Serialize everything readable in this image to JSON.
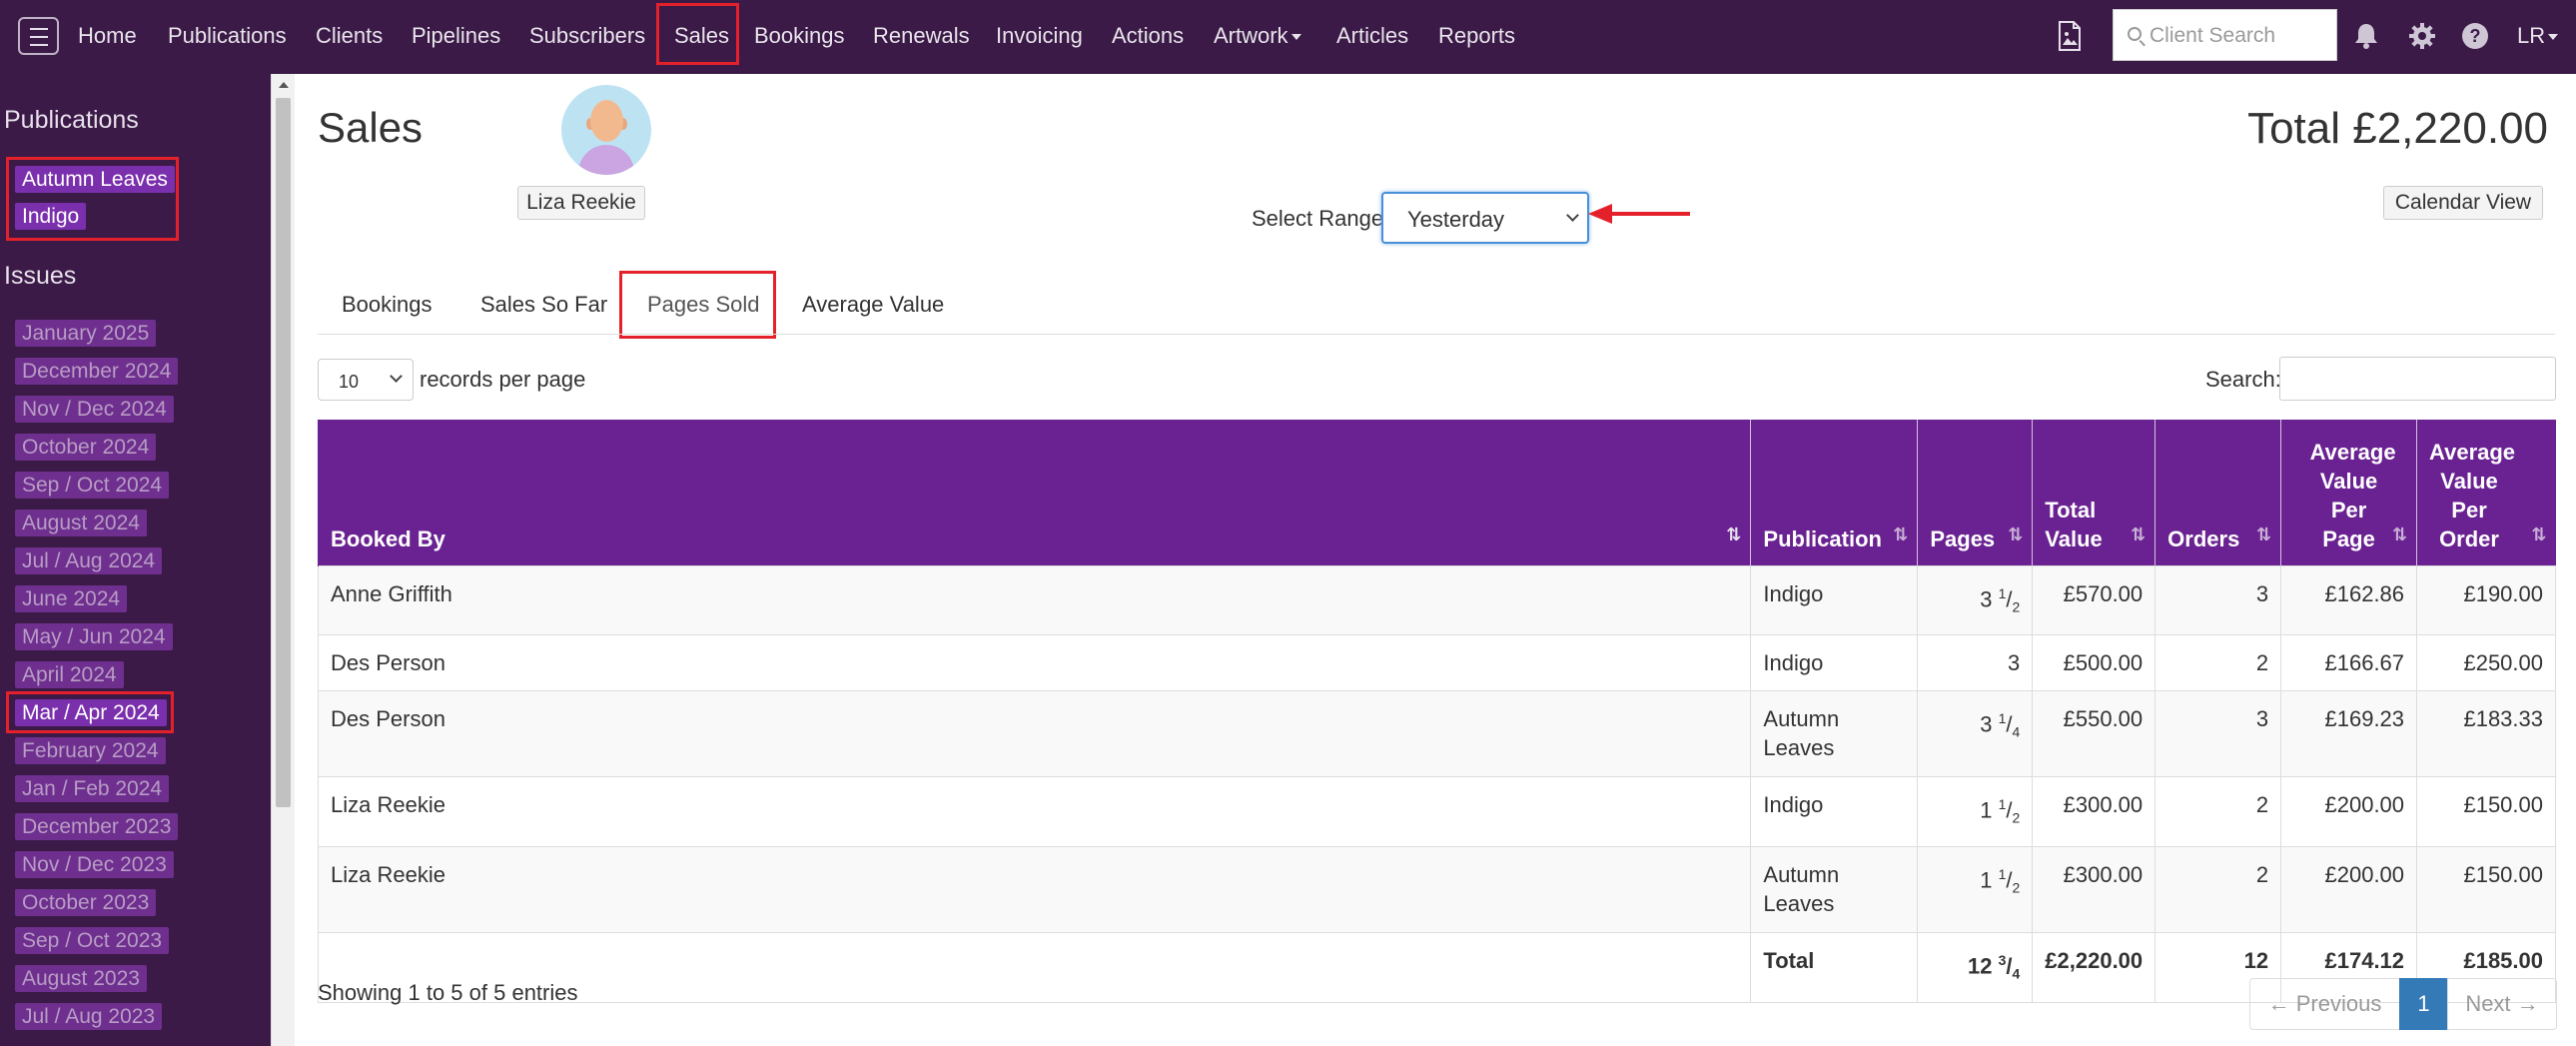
{
  "nav": {
    "items": [
      "Home",
      "Publications",
      "Clients",
      "Pipelines",
      "Subscribers",
      "Sales",
      "Bookings",
      "Renewals",
      "Invoicing",
      "Actions",
      "Artwork",
      "Articles",
      "Reports"
    ],
    "search_placeholder": "Client Search",
    "user": "LR",
    "colors": {
      "bar": "#3b1a47",
      "accent": "#6a2192",
      "highlight": "#e4212b"
    }
  },
  "sidebar": {
    "publications_heading": "Publications",
    "publications": [
      "Autumn Leaves",
      "Indigo"
    ],
    "issues_heading": "Issues",
    "issues": [
      "January 2025",
      "December 2024",
      "Nov / Dec 2024",
      "October 2024",
      "Sep / Oct 2024",
      "August 2024",
      "Jul / Aug 2024",
      "June 2024",
      "May / Jun 2024",
      "April 2024",
      "Mar / Apr 2024",
      "February 2024",
      "Jan / Feb 2024",
      "December 2023",
      "Nov / Dec 2023",
      "October 2023",
      "Sep / Oct 2023",
      "August 2023",
      "Jul / Aug 2023"
    ],
    "selected_issue": "Mar / Apr 2024"
  },
  "main": {
    "title": "Sales",
    "user_name": "Liza Reekie",
    "total": "Total £2,220.00",
    "range_label": "Select Range",
    "range_value": "Yesterday",
    "calendar_button": "Calendar View",
    "tabs": [
      "Bookings",
      "Sales So Far",
      "Pages Sold",
      "Average Value"
    ],
    "active_tab": "Pages Sold",
    "page_length": "10",
    "records_label": "records per page",
    "search_label": "Search:"
  },
  "table": {
    "headers": [
      "Booked By",
      "Publication",
      "Pages",
      "Total Value",
      "Orders",
      "Average Value Per Page",
      "Average Value Per Order"
    ],
    "rows": [
      {
        "booked_by": "Anne Griffith",
        "publication": "Indigo",
        "pages_whole": "3",
        "pages_num": "1",
        "pages_den": "2",
        "total_value": "£570.00",
        "orders": "3",
        "avg_page": "£162.86",
        "avg_order": "£190.00"
      },
      {
        "booked_by": "Des Person",
        "publication": "Indigo",
        "pages_whole": "3",
        "pages_num": "",
        "pages_den": "",
        "total_value": "£500.00",
        "orders": "2",
        "avg_page": "£166.67",
        "avg_order": "£250.00"
      },
      {
        "booked_by": "Des Person",
        "publication": "Autumn Leaves",
        "pages_whole": "3",
        "pages_num": "1",
        "pages_den": "4",
        "total_value": "£550.00",
        "orders": "3",
        "avg_page": "£169.23",
        "avg_order": "£183.33"
      },
      {
        "booked_by": "Liza Reekie",
        "publication": "Indigo",
        "pages_whole": "1",
        "pages_num": "1",
        "pages_den": "2",
        "total_value": "£300.00",
        "orders": "2",
        "avg_page": "£200.00",
        "avg_order": "£150.00"
      },
      {
        "booked_by": "Liza Reekie",
        "publication": "Autumn Leaves",
        "pages_whole": "1",
        "pages_num": "1",
        "pages_den": "2",
        "total_value": "£300.00",
        "orders": "2",
        "avg_page": "£200.00",
        "avg_order": "£150.00"
      }
    ],
    "footer": {
      "label": "Total",
      "pages_whole": "12",
      "pages_num": "3",
      "pages_den": "4",
      "total_value": "£2,220.00",
      "orders": "12",
      "avg_page": "£174.12",
      "avg_order": "£185.00"
    }
  },
  "pagination": {
    "info": "Showing 1 to 5 of 5 entries",
    "previous": "← Previous",
    "current": "1",
    "next": "Next →"
  }
}
